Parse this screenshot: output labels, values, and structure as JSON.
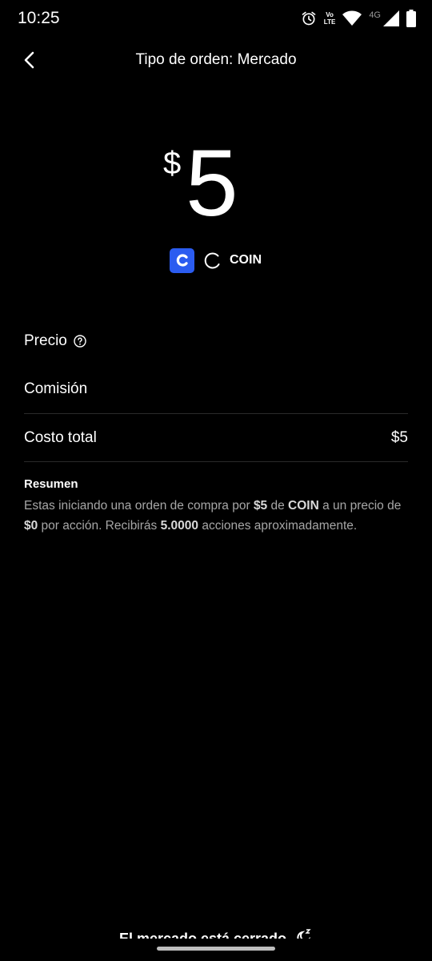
{
  "status_bar": {
    "time": "10:25",
    "volte_top": "Vo",
    "volte_bottom": "LTE",
    "network": "4G"
  },
  "header": {
    "title": "Tipo de orden: Mercado"
  },
  "amount": {
    "currency": "$",
    "value": "5"
  },
  "asset": {
    "logo_letter": "C",
    "ticker": "COIN"
  },
  "rows": {
    "price_label": "Precio",
    "fee_label": "Comisión",
    "total_label": "Costo total",
    "total_value": "$5"
  },
  "summary": {
    "title": "Resumen",
    "text_1": "Estas iniciando una orden de compra por ",
    "amount": "$5",
    "text_2": " de ",
    "ticker": "COIN",
    "text_3": " a un precio de ",
    "price": "$0",
    "text_4": " por acción. Recibirás ",
    "shares": "5.0000",
    "text_5": " acciones aproximadamente."
  },
  "footer": {
    "market_status": "El mercado está cerrado"
  },
  "colors": {
    "background": "#000000",
    "accent_blue": "#2b5cf0",
    "muted_text": "#a6a6a6"
  }
}
